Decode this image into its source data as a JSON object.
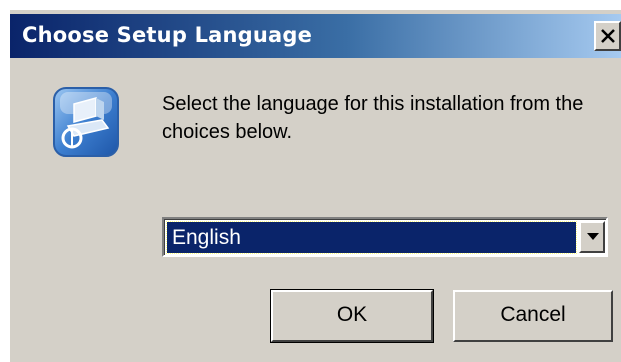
{
  "window": {
    "title": "Choose Setup Language",
    "close_icon": "close-icon"
  },
  "icon": {
    "name": "setup-computer-icon"
  },
  "message": "Select the language for this installation from the choices below.",
  "language_select": {
    "selected": "English"
  },
  "buttons": {
    "ok_label": "OK",
    "cancel_label": "Cancel"
  },
  "colors": {
    "title_bar_start": "#0a246a",
    "title_bar_end": "#a6caf0",
    "dialog_background": "#d4d0c8",
    "selection": "#0a246a"
  }
}
